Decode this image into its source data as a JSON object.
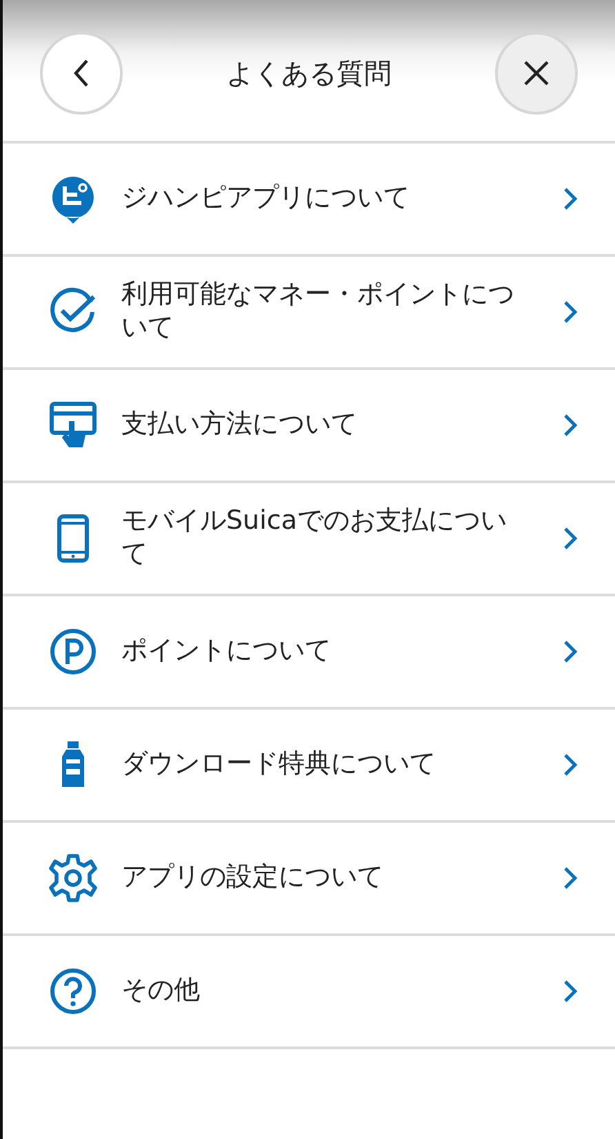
{
  "header": {
    "title": "よくある質問"
  },
  "items": [
    {
      "kind": "app",
      "label": "ジハンピアプリについて"
    },
    {
      "kind": "check",
      "label": "利用可能なマネー・ポイントについて"
    },
    {
      "kind": "card",
      "label": "支払い方法について"
    },
    {
      "kind": "phone",
      "label": "モバイルSuicaでのお支払について"
    },
    {
      "kind": "point",
      "label": "ポイントについて"
    },
    {
      "kind": "bottle",
      "label": "ダウンロード特典について"
    },
    {
      "kind": "gear",
      "label": "アプリの設定について"
    },
    {
      "kind": "question",
      "label": "その他"
    }
  ]
}
